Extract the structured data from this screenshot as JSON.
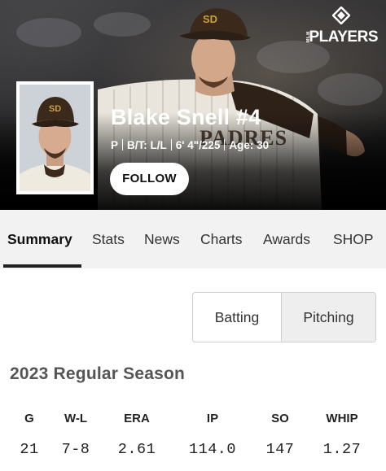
{
  "brand": {
    "logo_text": "PLAYERS",
    "logo_small": "MLB"
  },
  "player": {
    "name": "Blake Snell #4",
    "position": "P",
    "bats_throws": "B/T: L/L",
    "height_weight": "6' 4\"/225",
    "age": "Age: 30",
    "cap_logo": "SD",
    "jersey_text": "PADRES"
  },
  "actions": {
    "follow_label": "FOLLOW"
  },
  "tabs": [
    {
      "label": "Summary",
      "active": true
    },
    {
      "label": "Stats"
    },
    {
      "label": "News"
    },
    {
      "label": "Charts"
    },
    {
      "label": "Awards"
    },
    {
      "label": "SHOP"
    }
  ],
  "toggle": {
    "batting_label": "Batting",
    "pitching_label": "Pitching",
    "selected": "Pitching"
  },
  "season": {
    "title": "2023 Regular Season",
    "headers": [
      "G",
      "W-L",
      "ERA",
      "IP",
      "SO",
      "WHIP"
    ],
    "values": [
      "21",
      "7-8",
      "2.61",
      "114.0",
      "147",
      "1.27"
    ]
  },
  "colors": {
    "hero_bg": "#111111",
    "accent_brown": "#3b2a1c",
    "padres_gold": "#c9a13b",
    "tab_bg": "#f2f2f2"
  }
}
